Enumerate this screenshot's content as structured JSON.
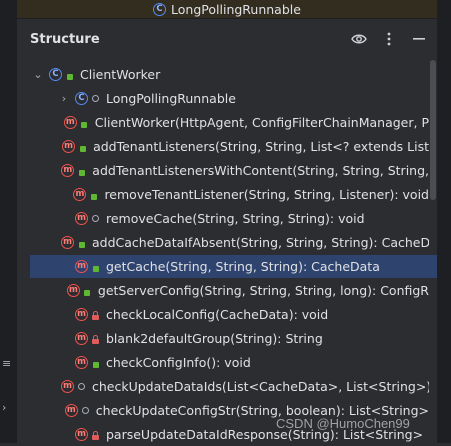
{
  "breadcrumb": {
    "title": "LongPollingRunnable",
    "icon": "class-icon"
  },
  "panel": {
    "title": "Structure",
    "actions": [
      {
        "name": "eye-icon",
        "label": "Show options"
      },
      {
        "name": "more-icon",
        "label": "More"
      },
      {
        "name": "minimize-icon",
        "label": "Hide"
      }
    ]
  },
  "tree": {
    "root": {
      "label": "ClientWorker",
      "icon": "class-icon",
      "expanded": true
    },
    "nodes": [
      {
        "label": "LongPollingRunnable",
        "kind": "class",
        "visibility": "package",
        "expandable": true
      },
      {
        "label": "ClientWorker(HttpAgent, ConfigFilterChainManager, P",
        "kind": "method",
        "visibility": "public"
      },
      {
        "label": "addTenantListeners(String, String, List<? extends List",
        "kind": "method",
        "visibility": "public"
      },
      {
        "label": "addTenantListenersWithContent(String, String, String,",
        "kind": "method",
        "visibility": "public"
      },
      {
        "label": "removeTenantListener(String, String, Listener): void",
        "kind": "method",
        "visibility": "public"
      },
      {
        "label": "removeCache(String, String, String): void",
        "kind": "method",
        "visibility": "package"
      },
      {
        "label": "addCacheDataIfAbsent(String, String, String): CacheD",
        "kind": "method",
        "visibility": "public"
      },
      {
        "label": "getCache(String, String, String): CacheData",
        "kind": "method",
        "visibility": "public",
        "selected": true
      },
      {
        "label": "getServerConfig(String, String, String, long): ConfigR",
        "kind": "method",
        "visibility": "public"
      },
      {
        "label": "checkLocalConfig(CacheData): void",
        "kind": "method",
        "visibility": "private"
      },
      {
        "label": "blank2defaultGroup(String): String",
        "kind": "method",
        "visibility": "private"
      },
      {
        "label": "checkConfigInfo(): void",
        "kind": "method",
        "visibility": "public"
      },
      {
        "label": "checkUpdateDataIds(List<CacheData>, List<String>):",
        "kind": "method",
        "visibility": "package"
      },
      {
        "label": "checkUpdateConfigStr(String, boolean): List<String>",
        "kind": "method",
        "visibility": "package"
      },
      {
        "label": "parseUpdateDataIdResponse(String): List<String>",
        "kind": "method",
        "visibility": "private"
      }
    ]
  },
  "watermark": "CSDN @HumoChen99",
  "colors": {
    "background": "#2b2d30",
    "selection": "#2e436e",
    "method_icon": "#f2514b",
    "class_icon": "#548af7",
    "public_marker": "#5fb832"
  }
}
